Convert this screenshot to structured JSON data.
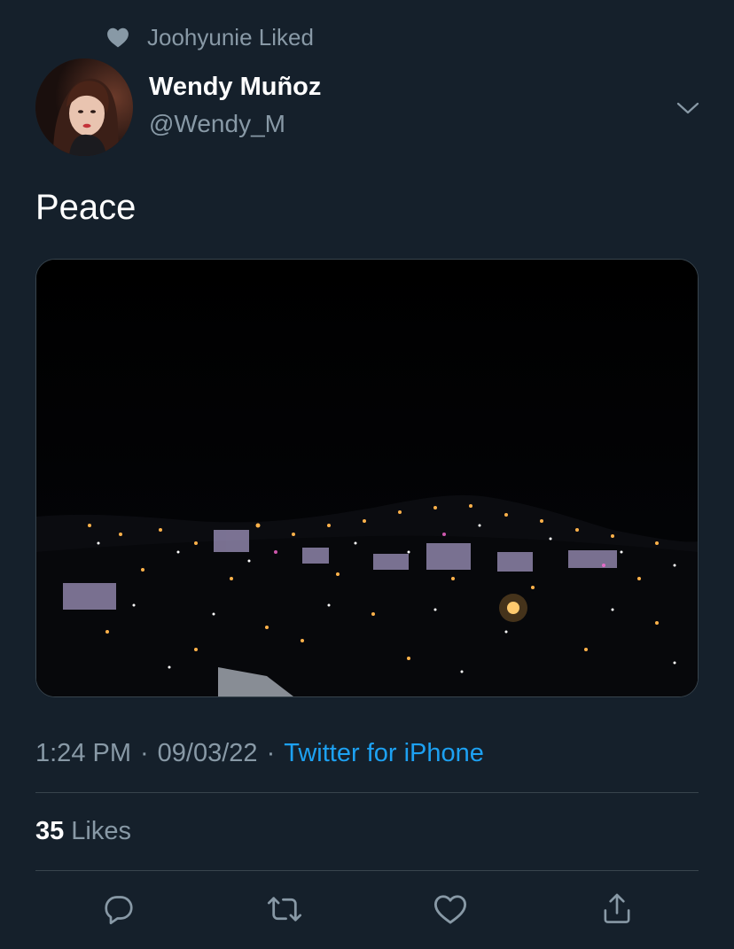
{
  "social_context": {
    "icon": "heart-icon",
    "text": "Joohyunie Liked"
  },
  "author": {
    "name": "Wendy Muñoz",
    "handle": "@Wendy_M",
    "avatar": "avatar-photo"
  },
  "tweet": {
    "text": "Peace",
    "media": "night city skyline photo"
  },
  "meta": {
    "time": "1:24 PM",
    "separator": "·",
    "date": "09/03/22",
    "source": "Twitter for iPhone"
  },
  "stats": {
    "likes_count": "35",
    "likes_label": "Likes"
  },
  "actions": {
    "reply_icon": "reply-icon",
    "retweet_icon": "retweet-icon",
    "like_icon": "like-icon",
    "share_icon": "share-icon"
  },
  "colors": {
    "background": "#15202b",
    "secondary_text": "#8899a6",
    "link": "#1da1f2",
    "divider": "#38444d"
  }
}
